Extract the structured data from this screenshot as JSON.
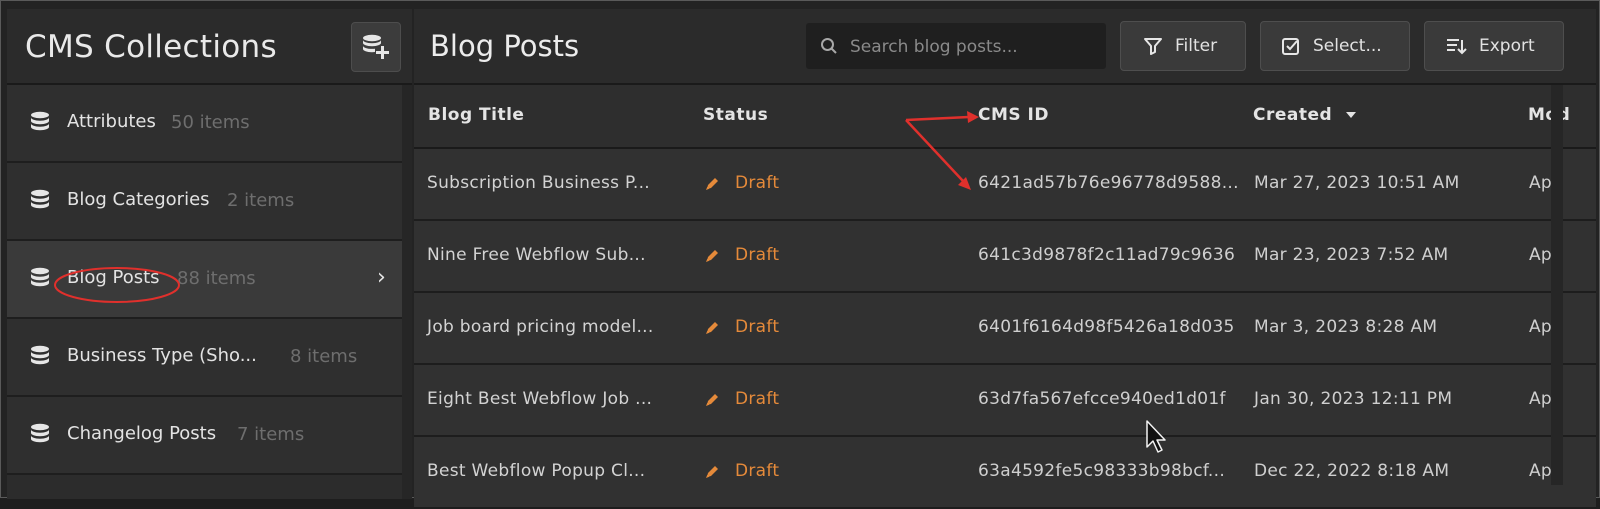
{
  "sidebar": {
    "title": "CMS Collections",
    "add_button_icon": "add-database-icon",
    "items": [
      {
        "label": "Attributes",
        "count": "50 items",
        "icon": "database-icon"
      },
      {
        "label": "Blog Categories",
        "count": "2 items",
        "icon": "database-icon"
      },
      {
        "label": "Blog Posts",
        "count": "88 items",
        "icon": "database-icon",
        "active": true
      },
      {
        "label": "Business Type (Sho...",
        "count": "8 items",
        "icon": "database-icon"
      },
      {
        "label": "Changelog Posts",
        "count": "7 items",
        "icon": "database-icon"
      }
    ]
  },
  "main": {
    "title": "Blog Posts",
    "search": {
      "placeholder": "Search blog posts...",
      "value": ""
    },
    "buttons": {
      "filter": "Filter",
      "select": "Select...",
      "export": "Export"
    },
    "columns": [
      "Blog Title",
      "Status",
      "CMS ID",
      "Created",
      "Mod"
    ],
    "rows": [
      {
        "title": "Subscription Business P...",
        "status": "Draft",
        "cms_id": "6421ad57b76e96778d9588...",
        "created": "Mar 27, 2023 10:51 AM",
        "modified": "Apr"
      },
      {
        "title": "Nine Free Webflow Sub...",
        "status": "Draft",
        "cms_id": "641c3d9878f2c11ad79c9636",
        "created": "Mar 23, 2023 7:52 AM",
        "modified": "Apr"
      },
      {
        "title": "Job board pricing model...",
        "status": "Draft",
        "cms_id": "6401f6164d98f5426a18d035",
        "created": "Mar 3, 2023 8:28 AM",
        "modified": "Apr"
      },
      {
        "title": "Eight Best Webflow Job ...",
        "status": "Draft",
        "cms_id": "63d7fa567efcce940ed1d01f",
        "created": "Jan 30, 2023 12:11 PM",
        "modified": "Apr"
      },
      {
        "title": "Best Webflow Popup Cl...",
        "status": "Draft",
        "cms_id": "63a4592fe5c98333b98bcf...",
        "created": "Dec 22, 2022 8:18 AM",
        "modified": "Apr"
      }
    ]
  },
  "colors": {
    "draft": "#e58a3a",
    "annotation": "#e0302c"
  }
}
